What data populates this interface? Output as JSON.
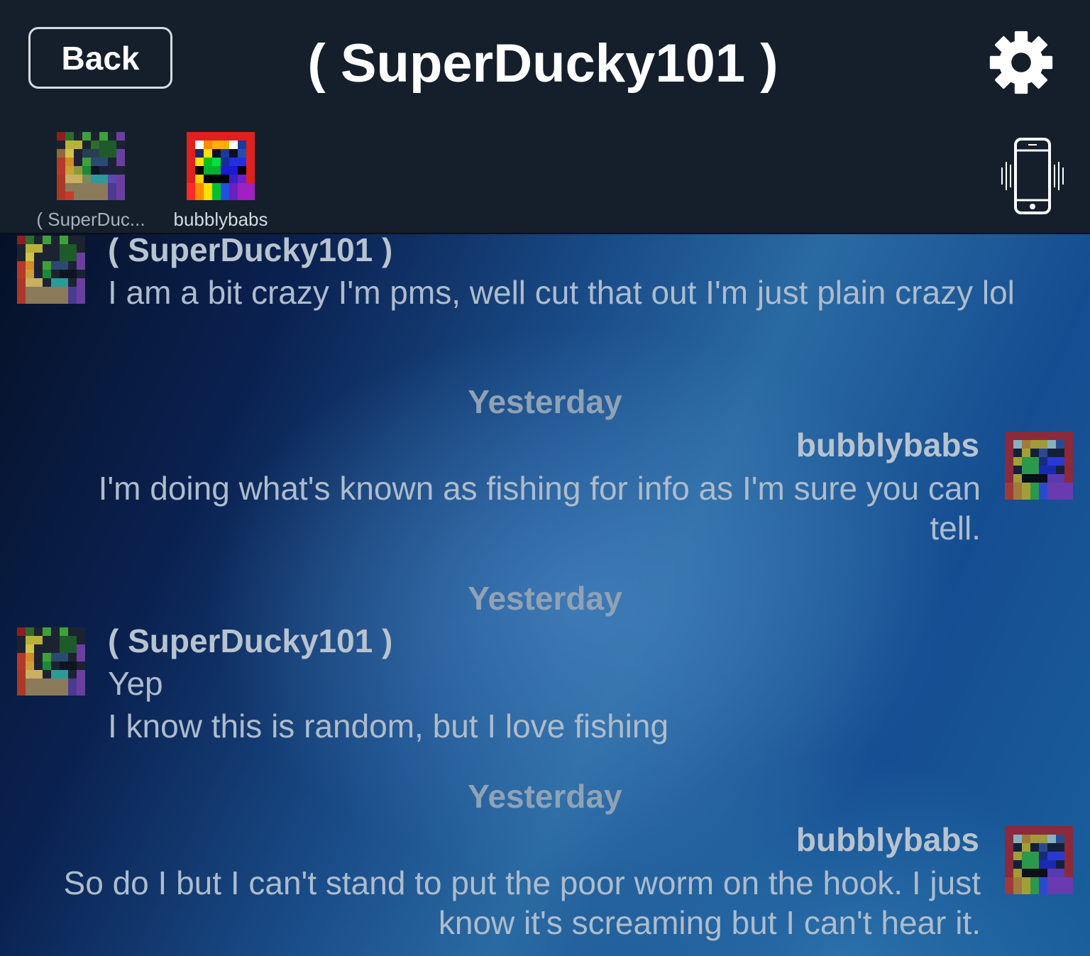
{
  "header": {
    "back_label": "Back",
    "title": "( SuperDucky101 )",
    "settings_icon": "gear-icon",
    "vibrate_icon": "phone-vibrate-icon"
  },
  "participants": [
    {
      "name": "( SuperDuc...",
      "avatar": "pixel-avatar-superducky"
    },
    {
      "name": "bubblybabs",
      "avatar": "pixel-avatar-bubblybabs"
    }
  ],
  "messages": [
    {
      "sender": "( SuperDucky101 )",
      "lines": [
        "I am a bit crazy I'm pms, well cut that out I'm just plain crazy lol"
      ]
    },
    {
      "date": "Yesterday",
      "sender": "bubblybabs",
      "lines": [
        "I'm doing what's known as fishing for info as I'm sure you can",
        "tell."
      ]
    },
    {
      "date": "Yesterday",
      "sender": "( SuperDucky101 )",
      "lines": [
        "Yep",
        "I know this is random, but I love fishing"
      ]
    },
    {
      "date": "Yesterday",
      "sender": "bubblybabs",
      "lines": [
        "So do I but I can't stand to put the poor worm on the hook.  I just",
        "know it's screaming but I can't hear it."
      ]
    }
  ]
}
